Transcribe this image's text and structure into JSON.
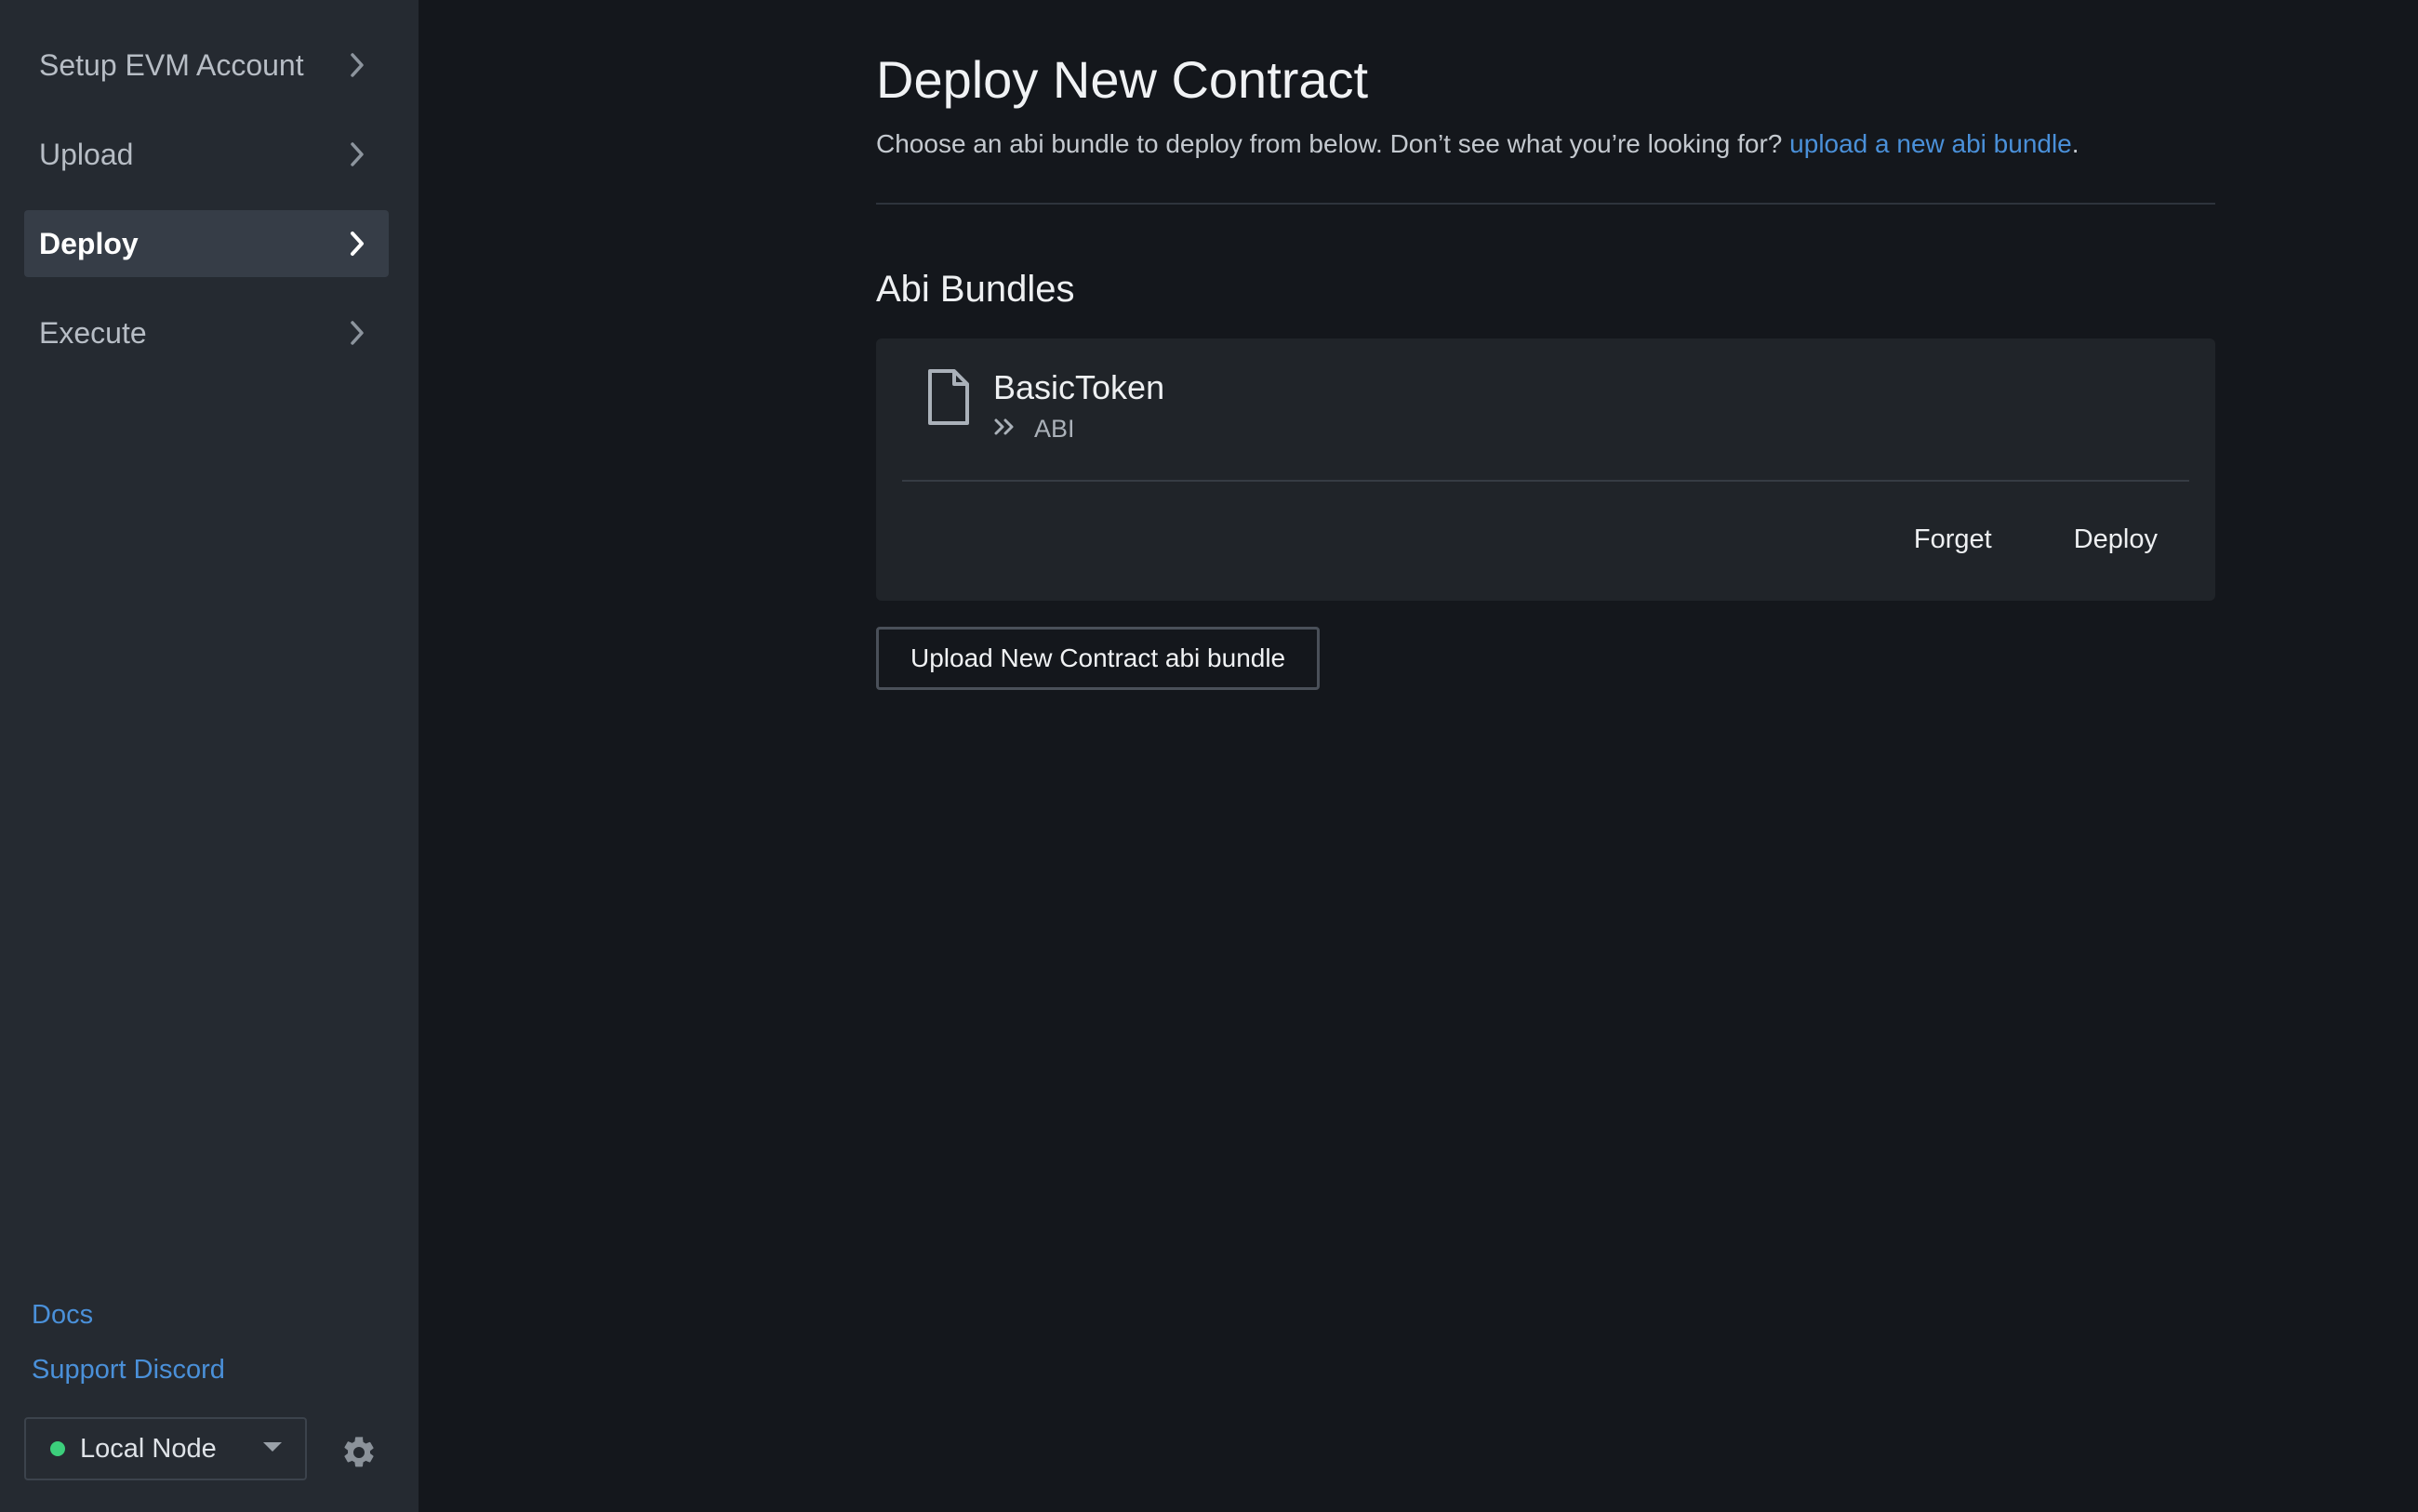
{
  "sidebar": {
    "items": [
      {
        "label": "Setup EVM Account",
        "active": false,
        "icon": "chevron-right-icon"
      },
      {
        "label": "Upload",
        "active": false,
        "icon": "chevron-right-icon"
      },
      {
        "label": "Deploy",
        "active": true,
        "icon": "chevron-right-icon"
      },
      {
        "label": "Execute",
        "active": false,
        "icon": "chevron-right-icon"
      }
    ],
    "links": {
      "docs": "Docs",
      "support": "Support Discord"
    },
    "node_selector": {
      "label": "Local Node",
      "status_color": "#3ccf7c",
      "icon": "caret-down-icon"
    },
    "settings_icon": "gear-icon"
  },
  "main": {
    "title": "Deploy New Contract",
    "subtitle": "Choose an abi bundle to deploy from below. Don’t see what you’re looking for? ",
    "subtitle_link": "upload a new abi bundle",
    "subtitle_end": ".",
    "section_title": "Abi Bundles",
    "bundles": [
      {
        "name": "BasicToken",
        "type": "ABI",
        "icon": "file-icon",
        "type_icon": "double-chevron-right-icon",
        "actions": {
          "forget": "Forget",
          "deploy": "Deploy"
        }
      }
    ],
    "upload_button": "Upload New Contract abi bundle"
  },
  "colors": {
    "accent_link": "#4a90d9",
    "sidebar_bg": "#252a31",
    "main_bg": "#14171c",
    "card_bg": "#202429"
  }
}
